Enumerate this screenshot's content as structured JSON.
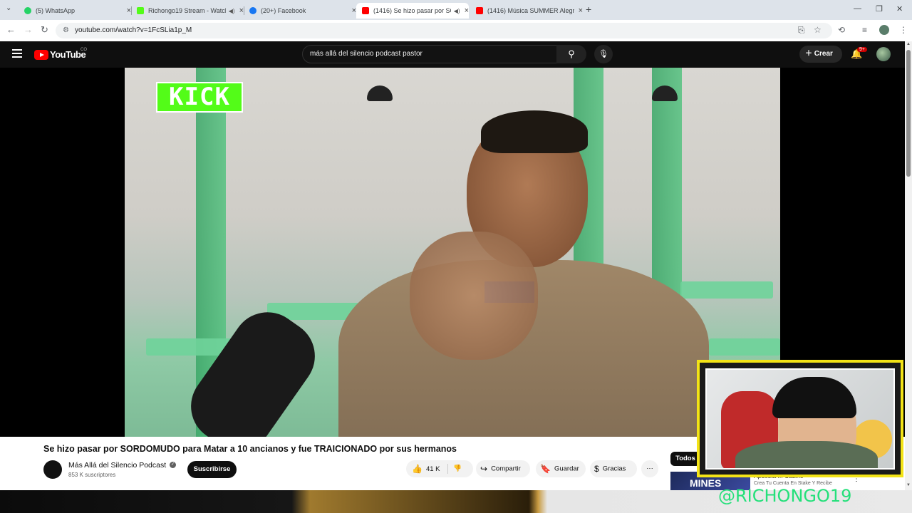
{
  "browser": {
    "tabs": [
      {
        "title": "(5) WhatsApp",
        "favicon": "whatsapp-icon",
        "color": "#25d366"
      },
      {
        "title": "Richongo19 Stream - Watch",
        "favicon": "kick-icon",
        "color": "#53fc18"
      },
      {
        "title": "(20+) Facebook",
        "favicon": "facebook-icon",
        "color": "#1877f2"
      },
      {
        "title": "(1416) Se hizo pasar por SO",
        "favicon": "youtube-icon",
        "color": "#ff0000"
      },
      {
        "title": "(1416) Música SUMMER Alegre",
        "favicon": "youtube-icon",
        "color": "#ff0000"
      }
    ],
    "url": "youtube.com/watch?v=1FcSLia1p_M"
  },
  "youtube": {
    "logo_text": "YouTube",
    "country": "CO",
    "search_value": "más allá del silencio podcast pastor",
    "create_label": "Crear",
    "notifications_badge": "9+"
  },
  "video": {
    "overlay_text": "KICK",
    "title": "Se hizo pasar por SORDOMUDO para Matar a 10 ancianos y fue TRAICIONADO por sus hermanos",
    "channel": "Más Allá del Silencio Podcast",
    "subscribers": "853 K suscriptores",
    "subscribe_label": "Suscribirse",
    "likes": "41 K",
    "share_label": "Compartir",
    "save_label": "Guardar",
    "thanks_label": "Gracias"
  },
  "sidebar": {
    "filter_chip": "Todos",
    "ad_title": "Apuesta ... Casino",
    "ad_sub": "Crea Tu Cuenta En Stake Y Recibe",
    "ad_thumb_text": "MINES"
  },
  "stream_overlay": {
    "handle": "@RICHONGO19"
  }
}
